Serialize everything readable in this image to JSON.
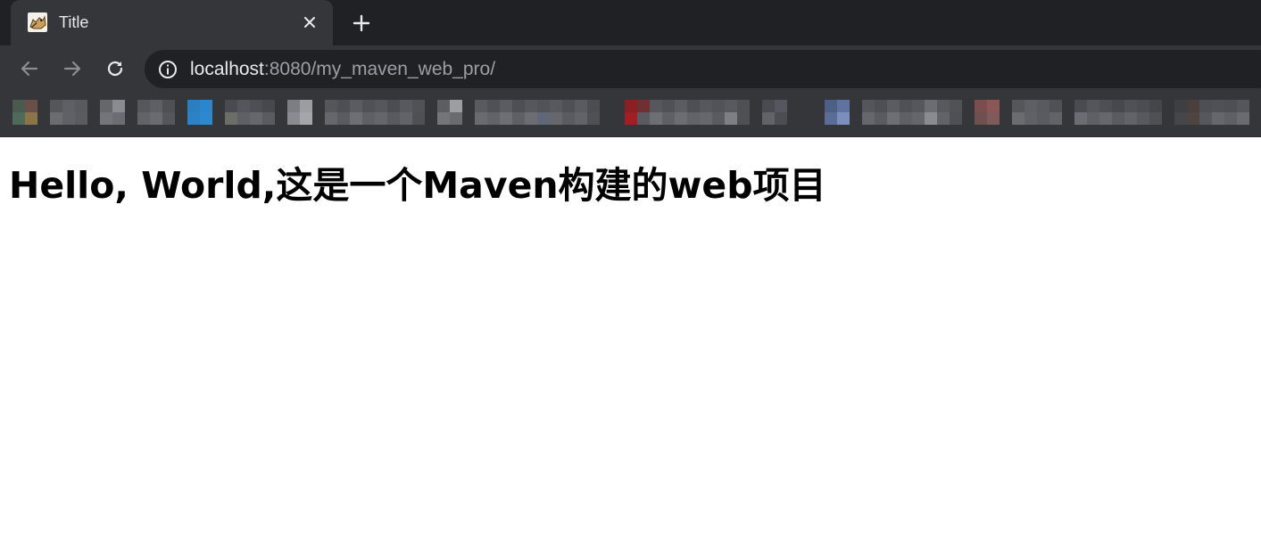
{
  "tab": {
    "title": "Title"
  },
  "toolbar": {
    "url_host": "localhost",
    "url_rest": ":8080/my_maven_web_pro/"
  },
  "page": {
    "heading": "Hello, World,这是一个Maven构建的web项目"
  },
  "colors": {
    "chrome_dark": "#202124",
    "chrome_tab": "#35363a",
    "url_host": "#e8eaed",
    "url_path": "#9aa0a6"
  }
}
